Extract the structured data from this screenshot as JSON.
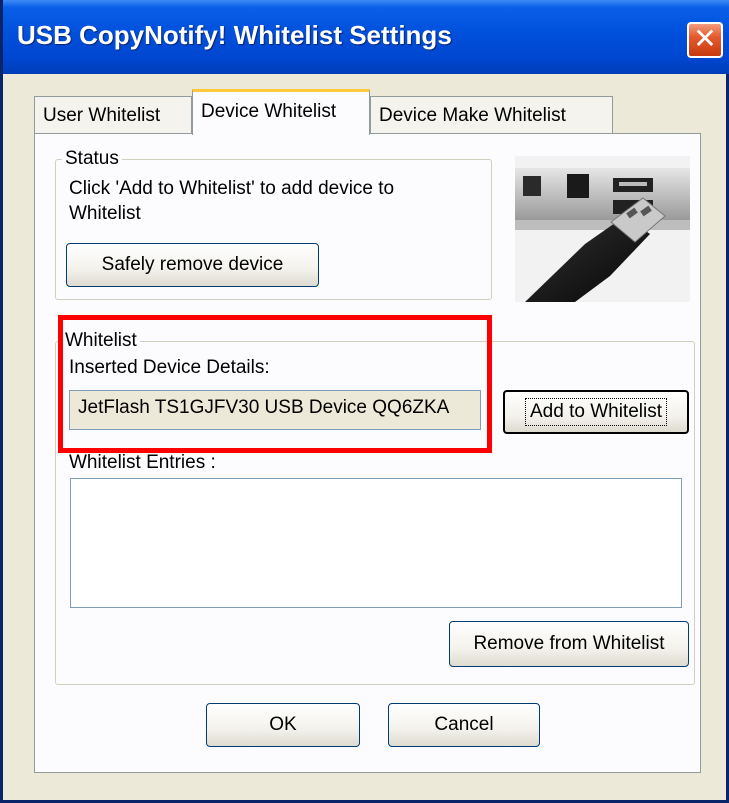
{
  "window": {
    "title": "USB CopyNotify! Whitelist Settings",
    "close_label": "✕"
  },
  "tabs": [
    {
      "label": "User Whitelist",
      "active": false
    },
    {
      "label": "Device Whitelist",
      "active": true
    },
    {
      "label": "Device Make Whitelist",
      "active": false
    }
  ],
  "status_group": {
    "legend": "Status",
    "message_line1": "Click 'Add to Whitelist' to add device to",
    "message_line2": "Whitelist",
    "safely_remove_label": "Safely remove device"
  },
  "whitelist_group": {
    "legend": "Whitelist",
    "inserted_label": "Inserted Device Details:",
    "inserted_value": "JetFlash TS1GJFV30 USB Device QQ6ZKA",
    "add_label": "Add to Whitelist",
    "entries_label": "Whitelist Entries :",
    "entries": [],
    "remove_label": "Remove from Whitelist"
  },
  "footer": {
    "ok_label": "OK",
    "cancel_label": "Cancel"
  },
  "colors": {
    "titlebar": "#0050dc",
    "highlight": "#ff0000",
    "dialog_bg": "#ece9d8",
    "close_button": "#e45a2e"
  },
  "icons": {
    "close": "close-icon",
    "device_image": "usb-port-image"
  }
}
